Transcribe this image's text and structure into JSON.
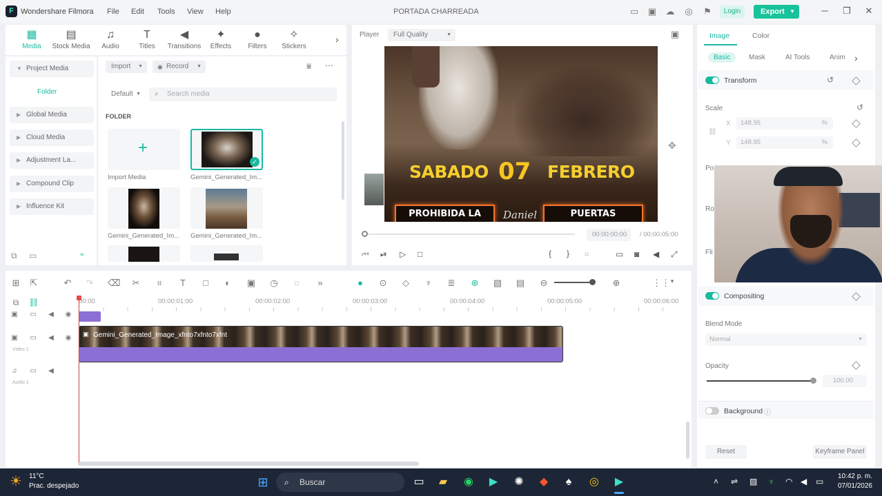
{
  "app": {
    "title": "Wondershare Filmora",
    "project_title": "PORTADA CHARREADA"
  },
  "menu": [
    "File",
    "Edit",
    "Tools",
    "View",
    "Help"
  ],
  "header": {
    "login_label": "Login",
    "export_label": "Export"
  },
  "media_tools": [
    {
      "label": "Media",
      "icon": "media-icon"
    },
    {
      "label": "Stock Media",
      "icon": "stock-media-icon"
    },
    {
      "label": "Audio",
      "icon": "audio-icon"
    },
    {
      "label": "Titles",
      "icon": "titles-icon"
    },
    {
      "label": "Transitions",
      "icon": "transitions-icon"
    },
    {
      "label": "Effects",
      "icon": "effects-icon"
    },
    {
      "label": "Filters",
      "icon": "filters-icon"
    },
    {
      "label": "Stickers",
      "icon": "stickers-icon"
    }
  ],
  "leftnav": {
    "items": [
      "Project Media",
      "Global Media",
      "Cloud Media",
      "Adjustment La...",
      "Compound Clip",
      "Influence Kit"
    ],
    "sub": "Folder"
  },
  "media": {
    "import_label": "Import",
    "record_label": "Record",
    "sort_label": "Default",
    "search_placeholder": "Search media",
    "folder_heading": "FOLDER",
    "import_media_label": "Import Media",
    "thumbs": [
      "Gemini_Generated_Im...",
      "Gemini_Generated_Im...",
      "Gemini_Generated_Im..."
    ]
  },
  "player": {
    "label": "Player",
    "quality": "Full Quality",
    "current_time": "00:00:00:00",
    "total_time": "/ 00:00:05:00",
    "frame": {
      "day": "SABADO",
      "date": "07",
      "month": "FEBRERO",
      "banner_left": "PROHIBIDA LA",
      "banner_right": "PUERTAS",
      "signature": "Daniel"
    }
  },
  "inspector": {
    "tabs": [
      "Image",
      "Color"
    ],
    "subtabs": [
      "Basic",
      "Mask",
      "AI Tools",
      "Anim"
    ],
    "transform_label": "Transform",
    "scale_label": "Scale",
    "x_label": "X",
    "y_label": "Y",
    "scale_x": "148.95",
    "scale_y": "148.95",
    "percent": "%",
    "cut_labels": [
      "Po",
      "Ro",
      "Fli"
    ],
    "compositing_label": "Compositing",
    "blend_mode_label": "Blend Mode",
    "blend_mode_value": "Normal",
    "opacity_label": "Opacity",
    "opacity_value": "100.00",
    "opacity_fraction": 1.0,
    "background_label": "Background",
    "reset_label": "Reset",
    "keyframe_label": "Keyframe Panel"
  },
  "timeline": {
    "ruler": [
      "00:00",
      "00:00:01:00",
      "00:00:02:00",
      "00:00:03:00",
      "00:00:04:00",
      "00:00:05:00",
      "00:00:06:00"
    ],
    "clip_label": "Gemini_Generated_Image_xfnto7xfnto7xfnt",
    "video_track": "Video 1",
    "audio_track": "Audio 1"
  },
  "taskbar": {
    "temperature": "11°C",
    "weather": "Prac. despejado",
    "search": "Buscar",
    "time": "10:42 p. m.",
    "date": "07/01/2026"
  },
  "colors": {
    "accent": "#19b9a0",
    "export": "#17c39a",
    "clip": "#8c6fd4",
    "playhead": "#e34a4a"
  }
}
